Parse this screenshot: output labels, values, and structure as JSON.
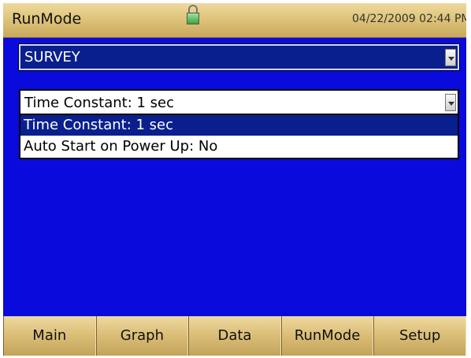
{
  "title_bar": {
    "app_title": "RunMode",
    "datetime": "04/22/2009 02:44 PM"
  },
  "mode_dropdown": {
    "value": "SURVEY"
  },
  "time_constant_dropdown": {
    "value": "Time Constant: 1 sec"
  },
  "list": {
    "items": [
      {
        "label": "Time Constant: 1 sec",
        "selected": true
      },
      {
        "label": "Auto Start on Power Up: No",
        "selected": false
      }
    ]
  },
  "tabs": [
    {
      "label": "Main"
    },
    {
      "label": "Graph"
    },
    {
      "label": "Data"
    },
    {
      "label": "RunMode"
    },
    {
      "label": "Setup"
    }
  ],
  "colors": {
    "screen_bg": "#0a0adc",
    "selection": "#0a1f8e",
    "bar": "#e0c77e"
  },
  "icons": {
    "lock": "lock-icon"
  }
}
